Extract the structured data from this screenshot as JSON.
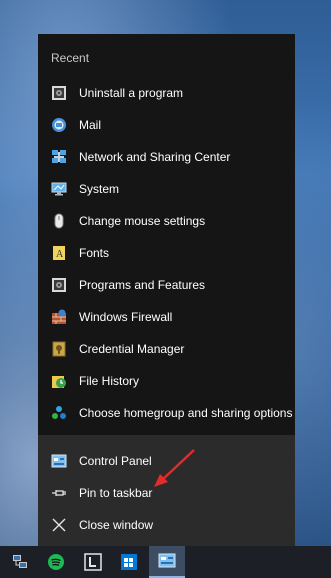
{
  "jumplist": {
    "recent_header": "Recent",
    "recent_items": [
      {
        "label": "Uninstall a program",
        "icon": "programs-icon"
      },
      {
        "label": "Mail",
        "icon": "mail-icon"
      },
      {
        "label": "Network and Sharing Center",
        "icon": "network-icon"
      },
      {
        "label": "System",
        "icon": "system-icon"
      },
      {
        "label": "Change mouse settings",
        "icon": "mouse-icon"
      },
      {
        "label": "Fonts",
        "icon": "fonts-icon"
      },
      {
        "label": "Programs and Features",
        "icon": "programs-icon"
      },
      {
        "label": "Windows Firewall",
        "icon": "firewall-icon"
      },
      {
        "label": "Credential Manager",
        "icon": "credential-icon"
      },
      {
        "label": "File History",
        "icon": "file-history-icon"
      },
      {
        "label": "Choose homegroup and sharing options",
        "icon": "homegroup-icon"
      }
    ],
    "tasks": [
      {
        "label": "Control Panel",
        "icon": "control-panel-icon"
      },
      {
        "label": "Pin to taskbar",
        "icon": "pin-icon"
      },
      {
        "label": "Close window",
        "icon": "close-icon"
      }
    ]
  },
  "taskbar": {
    "apps": [
      {
        "name": "network-tray-icon"
      },
      {
        "name": "spotify-icon"
      },
      {
        "name": "app-l-icon"
      },
      {
        "name": "store-icon"
      },
      {
        "name": "control-panel-taskbar-icon",
        "active": true
      }
    ]
  },
  "colors": {
    "jumplist_bg": "#151515",
    "tasks_bg": "#2b2b2b",
    "arrow": "#e32b2b",
    "spotify": "#1db954",
    "accent": "#0078d7"
  }
}
